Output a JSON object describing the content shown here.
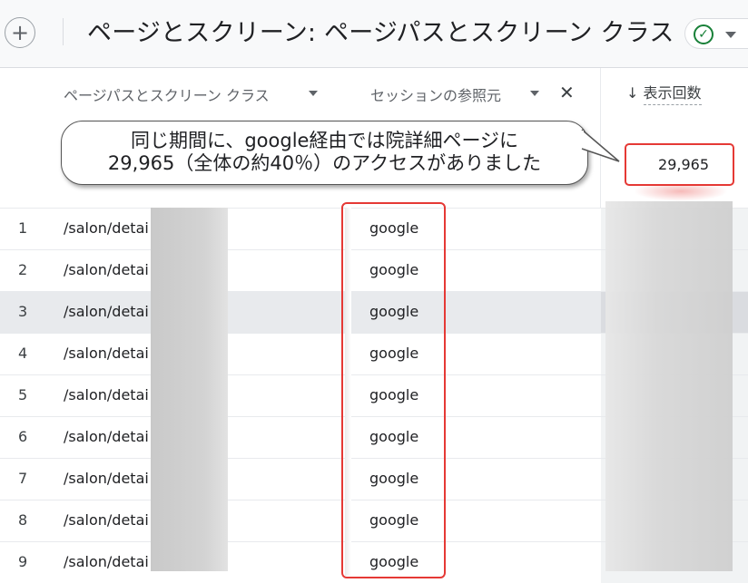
{
  "header": {
    "add_icon": "plus-icon",
    "title": "ページとスクリーン: ページパスとスクリーン クラス",
    "status_icon": "check-circle-icon"
  },
  "columns": {
    "dimension1": "ページパスとスクリーン クラス",
    "dimension2": "セッションの参照元",
    "metric_arrow": "↓",
    "metric": "表示回数",
    "metric_total": "29,965"
  },
  "callout": {
    "line1": "同じ期間に、google経由では院詳細ページに",
    "line2": "29,965（全体の約40％）のアクセスがありました"
  },
  "rows": [
    {
      "rank": "1",
      "path": "/salon/detai",
      "source": "google"
    },
    {
      "rank": "2",
      "path": "/salon/detai",
      "source": "google"
    },
    {
      "rank": "3",
      "path": "/salon/detai",
      "source": "google"
    },
    {
      "rank": "4",
      "path": "/salon/detai",
      "source": "google"
    },
    {
      "rank": "5",
      "path": "/salon/detai",
      "source": "google"
    },
    {
      "rank": "6",
      "path": "/salon/detai",
      "source": "google"
    },
    {
      "rank": "7",
      "path": "/salon/detai",
      "source": "google"
    },
    {
      "rank": "8",
      "path": "/salon/detai",
      "source": "google"
    },
    {
      "rank": "9",
      "path": "/salon/detai",
      "source": "google"
    }
  ],
  "highlight_color": "#e53935"
}
